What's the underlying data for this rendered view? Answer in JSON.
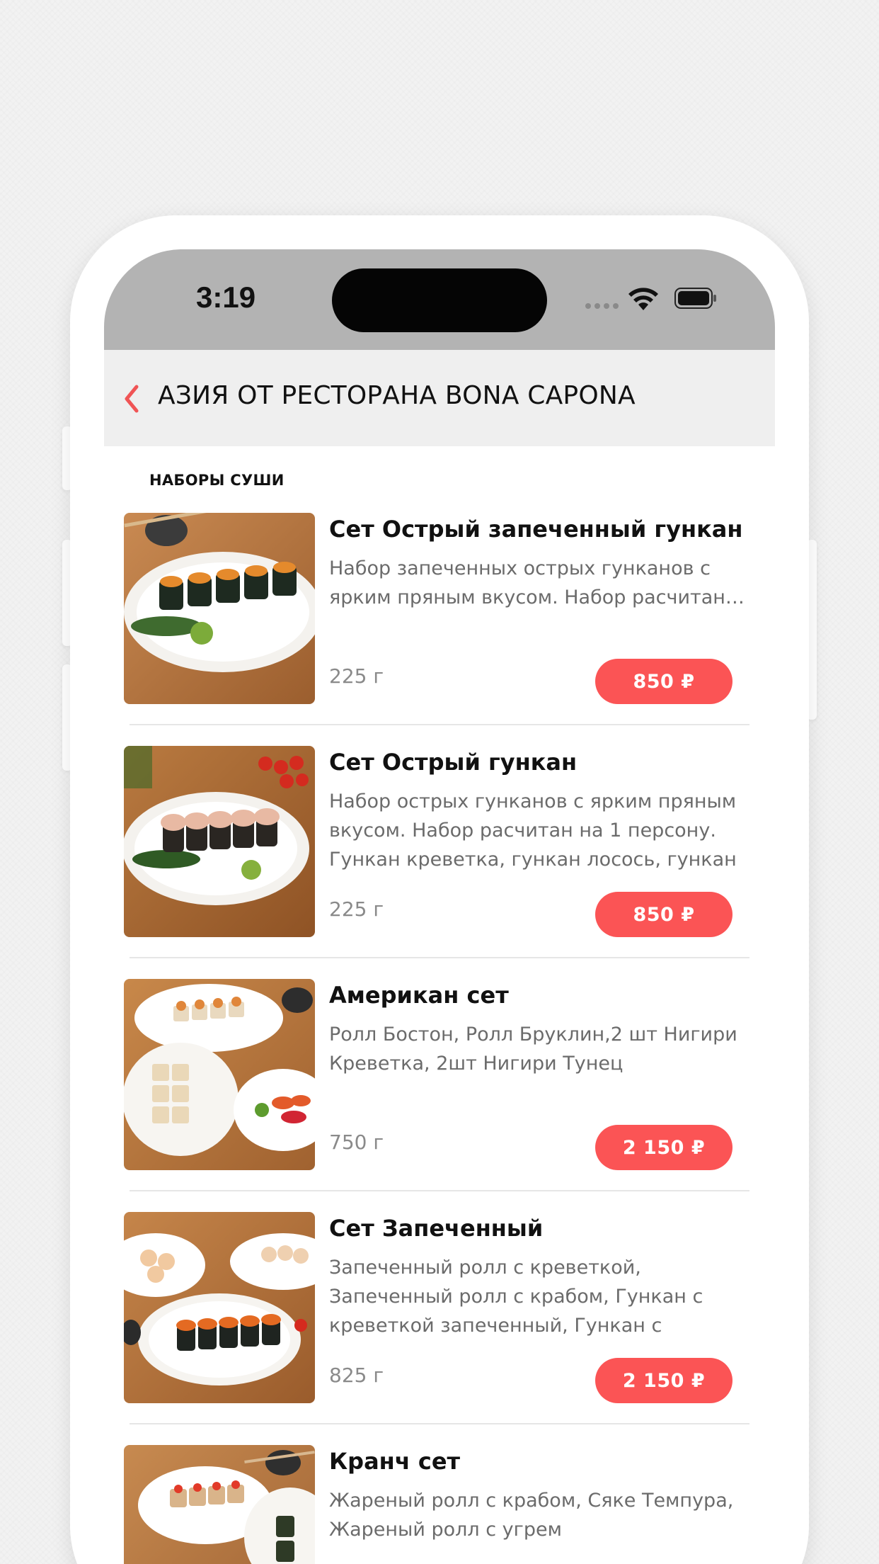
{
  "status_bar": {
    "time": "3:19"
  },
  "nav": {
    "title": "АЗИЯ ОТ РЕСТОРАНА BONA CAPONA",
    "back_icon": "chevron-left-icon"
  },
  "section": {
    "title": "НАБОРЫ СУШИ"
  },
  "colors": {
    "accent": "#fb5455",
    "status_bar_bg": "#b3b3b3",
    "nav_bg": "#efefef"
  },
  "items": [
    {
      "name": "Сет Острый запеченный гункан",
      "description": "Набор запеченных острых гунканов с ярким пряным вкусом. Набор расчитан…",
      "weight": "225 г",
      "price": "850 ₽"
    },
    {
      "name": "Сет Острый гункан",
      "description": "Набор острых гунканов с ярким пряным вкусом. Набор расчитан на 1 персону. Гункан креветка, гункан лосось, гункан у…",
      "weight": "225 г",
      "price": "850 ₽"
    },
    {
      "name": "Американ сет",
      "description": "Ролл Бостон, Ролл Бруклин,2 шт Нигири Креветка, 2шт Нигири Тунец",
      "weight": "750 г",
      "price": "2 150 ₽"
    },
    {
      "name": "Сет Запеченный",
      "description": "Запеченный ролл с креветкой, Запеченный ролл с крабом, Гункан с креветкой запеченный, Гункан с тунцом…",
      "weight": "825 г",
      "price": "2 150 ₽"
    },
    {
      "name": "Кранч сет",
      "description": "Жареный ролл с крабом, Сяке Темпура, Жареный ролл с угрем",
      "weight": "",
      "price": ""
    }
  ]
}
